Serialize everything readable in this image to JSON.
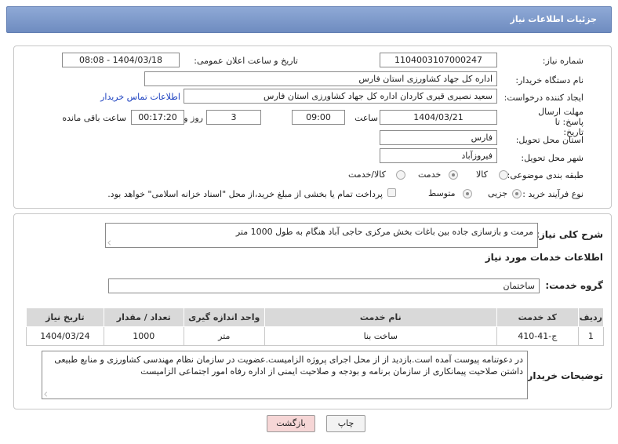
{
  "header": {
    "title": "جزئیات اطلاعات نیاز"
  },
  "form": {
    "need_number_label": "شماره نیاز:",
    "need_number": "1104003107000247",
    "announce_label": "تاریخ و ساعت اعلان عمومی:",
    "announce_value": "1404/03/18 - 08:08",
    "buyer_org_label": "نام دستگاه خریدار:",
    "buyer_org": "اداره کل جهاد کشاورزی استان فارس",
    "creator_label": "ایجاد کننده درخواست:",
    "creator": "سعید نصیری قیری کاردان اداره کل جهاد کشاورزی استان فارس",
    "contact_link": "اطلاعات تماس خریدار",
    "deadline_label": "مهلت ارسال پاسخ: تا تاریخ:",
    "deadline_date": "1404/03/21",
    "time_label": "ساعت",
    "deadline_time": "09:00",
    "days_value": "3",
    "days_label": "روز و",
    "remaining_time": "00:17:20",
    "remaining_label": "ساعت باقی مانده",
    "province_label": "استان محل تحویل:",
    "province": "فارس",
    "city_label": "شهر محل تحویل:",
    "city": "فیروزآباد",
    "category_label": "طبقه بندی موضوعی:",
    "category_options": [
      "کالا",
      "خدمت",
      "کالا/خدمت"
    ],
    "category_selected": "خدمت",
    "process_label": "نوع فرآیند خرید :",
    "process_options": [
      "جزیی",
      "متوسط"
    ],
    "process_selected": "جزیی",
    "treasury_note": "پرداخت تمام یا بخشی از مبلغ خرید،از محل \"اسناد خزانه اسلامی\" خواهد بود."
  },
  "summary": {
    "label": "شرح کلی نیاز:",
    "text": "مرمت و بازسازی جاده بین باغات  بخش مرکزی حاجی آباد هنگام  به طول 1000 متر"
  },
  "services": {
    "section_title": "اطلاعات خدمات مورد نیاز",
    "group_label": "گروه خدمت:",
    "group_value": "ساختمان",
    "columns": [
      "ردیف",
      "کد خدمت",
      "نام خدمت",
      "واحد اندازه گیری",
      "تعداد / مقدار",
      "تاریخ نیاز"
    ],
    "rows": [
      {
        "index": "1",
        "code": "ج-41-410",
        "name": "ساخت بنا",
        "unit": "متر",
        "qty": "1000",
        "date": "1404/03/24"
      }
    ]
  },
  "notes": {
    "label": "توضیحات خریدار:",
    "text": "در دعوتنامه پیوست آمده است.بازدید از از محل اجرای پروژه الزامیست.عضویت در سازمان نظام مهندسی کشاورزی و منابع طبیعی  داشتن صلاحیت پیمانکاری از سازمان برنامه و بودجه و صلاحیت ایمنی از اداره رفاه امور اجتماعی الزامیست"
  },
  "buttons": {
    "print": "چاپ",
    "back": "بازگشت"
  },
  "colors": {
    "header": "#7b96c8",
    "back_button": "#f6d6d6",
    "link": "#1a3fbf"
  }
}
